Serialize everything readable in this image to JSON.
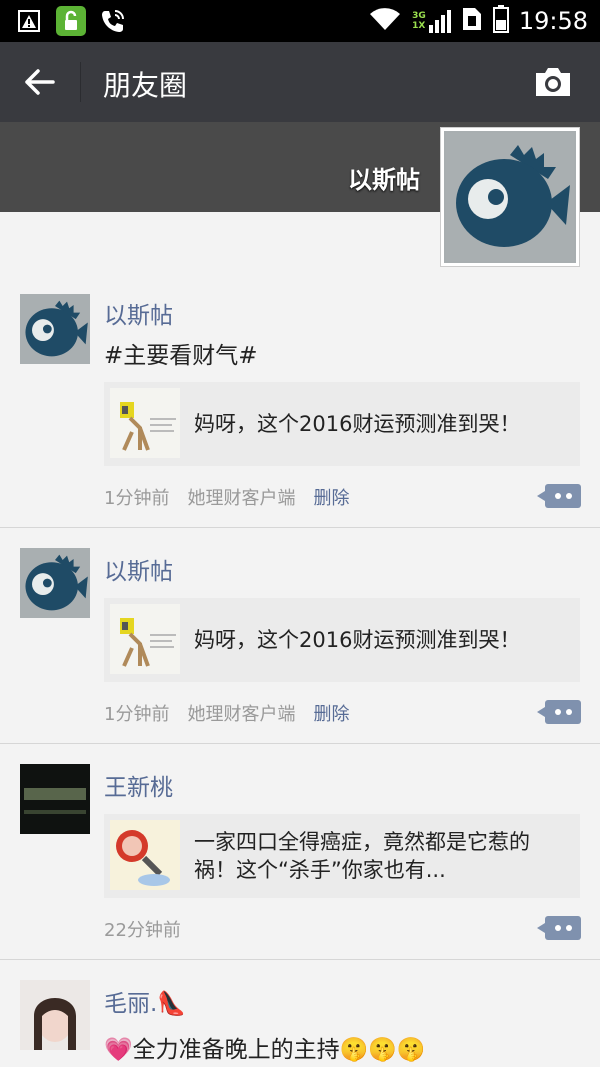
{
  "status_bar": {
    "time": "19:58",
    "net_top": "3G",
    "net_bottom": "1X"
  },
  "header": {
    "title": "朋友圈"
  },
  "cover": {
    "name": "以斯帖"
  },
  "posts": [
    {
      "author": "以斯帖",
      "text": "#主要看财气#",
      "share_title": "妈呀，这个2016财运预测准到哭！",
      "time": "1分钟前",
      "source": "她理财客户端",
      "delete": "删除"
    },
    {
      "author": "以斯帖",
      "share_title": "妈呀，这个2016财运预测准到哭！",
      "time": "1分钟前",
      "source": "她理财客户端",
      "delete": "删除"
    },
    {
      "author": "王新桃",
      "share_title": "一家四口全得癌症，竟然都是它惹的祸！这个“杀手”你家也有...",
      "time": "22分钟前"
    },
    {
      "author": "毛丽.👠",
      "text": "💗全力准备晚上的主持🤫🤫🤫"
    }
  ],
  "colors": {
    "link": "#576b95",
    "actionbar": "#393a3f"
  }
}
